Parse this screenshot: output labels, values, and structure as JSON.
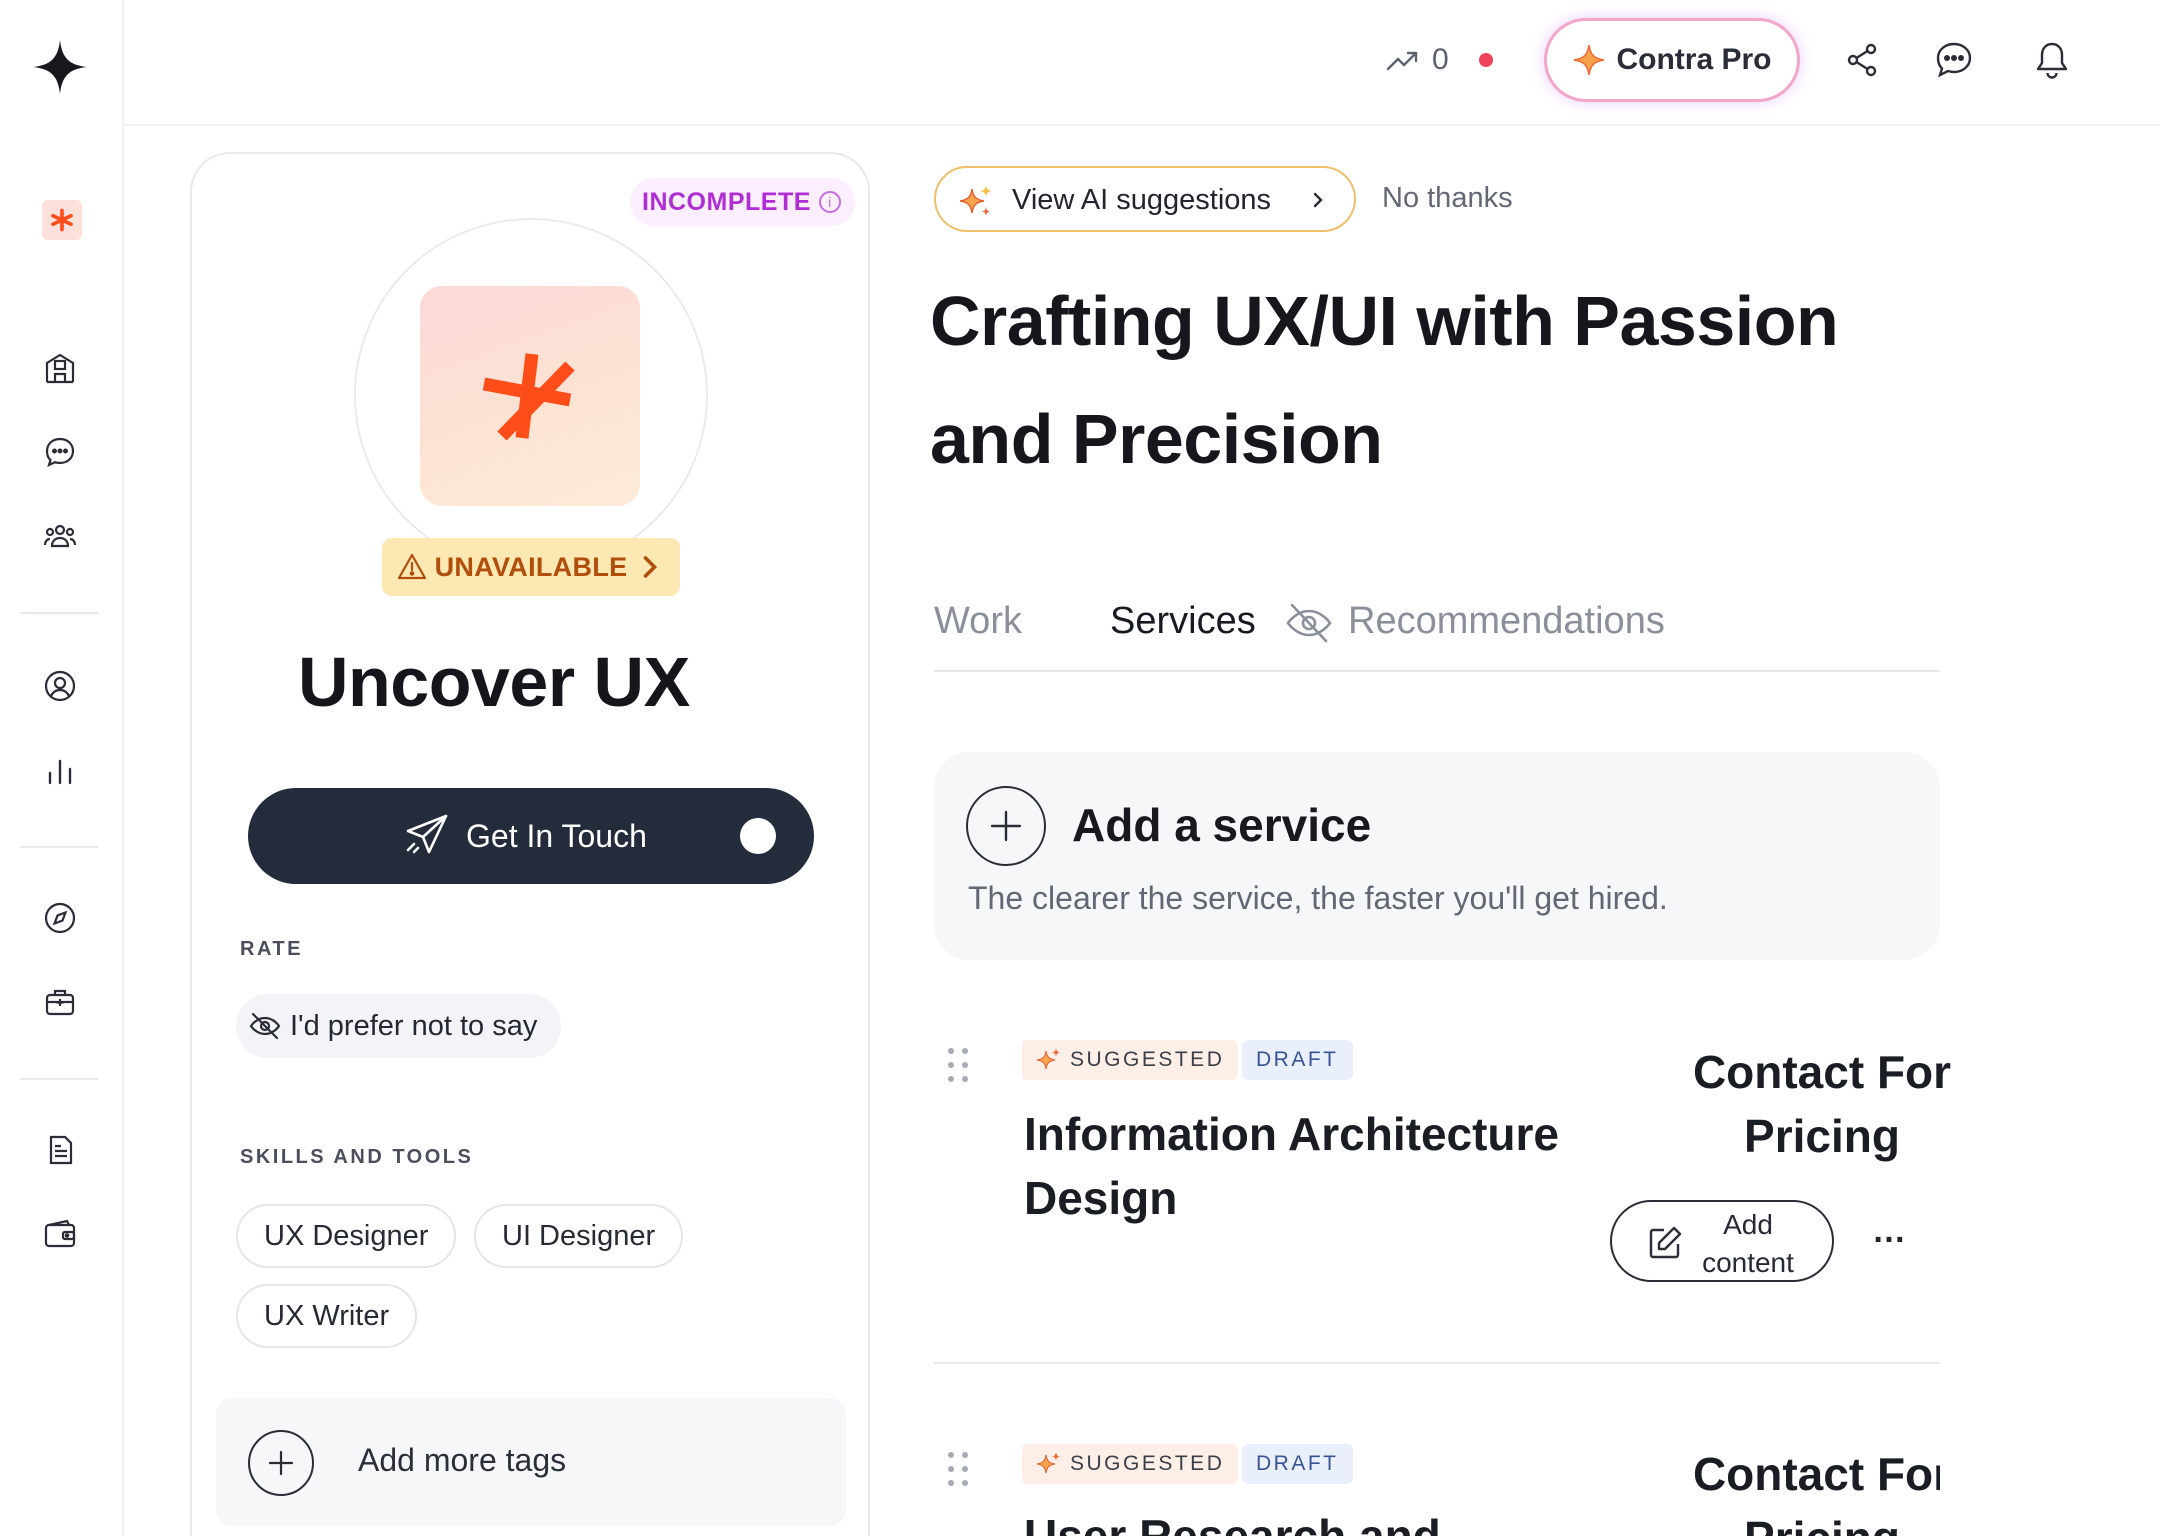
{
  "topbar": {
    "trend_count": "0",
    "pro_label": "Contra Pro"
  },
  "profile": {
    "status_badge": "INCOMPLETE",
    "availability": "UNAVAILABLE",
    "name": "Uncover UX",
    "cta_label": "Get In Touch",
    "rate_heading": "RATE",
    "rate_value": "I'd prefer not to say",
    "skills_heading": "SKILLS AND TOOLS",
    "skills": [
      "UX Designer",
      "UI Designer",
      "UX Writer"
    ],
    "add_tags_label": "Add more tags"
  },
  "main": {
    "ai_suggestions_label": "View AI suggestions",
    "no_thanks_label": "No thanks",
    "headline": "Crafting UX/UI with Passion and Precision",
    "tabs": [
      {
        "label": "Work",
        "active": false
      },
      {
        "label": "Services",
        "active": true
      },
      {
        "label": "Recommendations",
        "active": false
      }
    ],
    "add_service": {
      "title": "Add a service",
      "subtitle": "The clearer the service, the faster you'll get hired."
    },
    "services": [
      {
        "badge_suggested": "SUGGESTED",
        "badge_draft": "DRAFT",
        "title": "Information Architecture Design",
        "price": "Contact For Pricing",
        "add_content_label": "Add content",
        "more_label": "…"
      },
      {
        "badge_suggested": "SUGGESTED",
        "badge_draft": "DRAFT",
        "title": "User Research and",
        "price": "Contact For Pricing"
      }
    ]
  },
  "colors": {
    "accent_orange": "#ff4d1a",
    "cta_dark": "#242b3a",
    "incomplete_purple": "#b02fd4",
    "unavailable_bg": "#fde7b2"
  },
  "icons": [
    "contra-logo-icon",
    "avatar-mini-icon",
    "home-icon",
    "chat-icon",
    "community-icon",
    "profile-icon",
    "analytics-icon",
    "compass-icon",
    "briefcase-icon",
    "document-icon",
    "wallet-icon",
    "trend-icon",
    "share-icon",
    "messages-icon",
    "bell-icon",
    "sparkle-icon",
    "warning-icon",
    "send-icon",
    "hidden-eye-icon",
    "plus-icon",
    "edit-icon",
    "drag-handle-icon"
  ]
}
